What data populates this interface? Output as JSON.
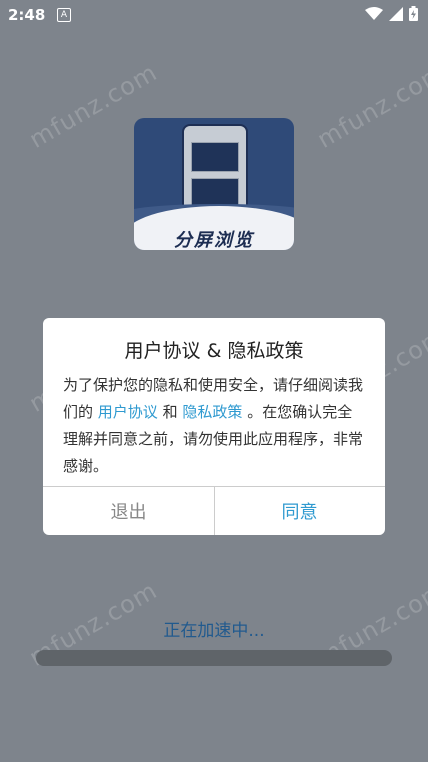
{
  "status_bar": {
    "time": "2:48",
    "notification_icon": "a-badge-icon",
    "right_icons": [
      "wifi-icon",
      "signal-icon",
      "battery-icon"
    ]
  },
  "watermark": "mfunz.com",
  "app": {
    "brand_name": "分屏浏览"
  },
  "dialog": {
    "title": "用户协议 & 隐私政策",
    "body_prefix": "为了保护您的隐私和使用安全，请仔细阅读我们的",
    "user_agreement_link": "用户协议",
    "and_text": "和",
    "privacy_link": "隐私政策",
    "body_suffix": "。在您确认完全理解并同意之前，请勿使用此应用程序，非常感谢。",
    "exit_label": "退出",
    "agree_label": "同意"
  },
  "loading": {
    "text": "正在加速中...",
    "progress": 0
  },
  "colors": {
    "accent": "#2f9ad0",
    "loading_text": "#215a8e",
    "backdrop": "#7e848c"
  }
}
